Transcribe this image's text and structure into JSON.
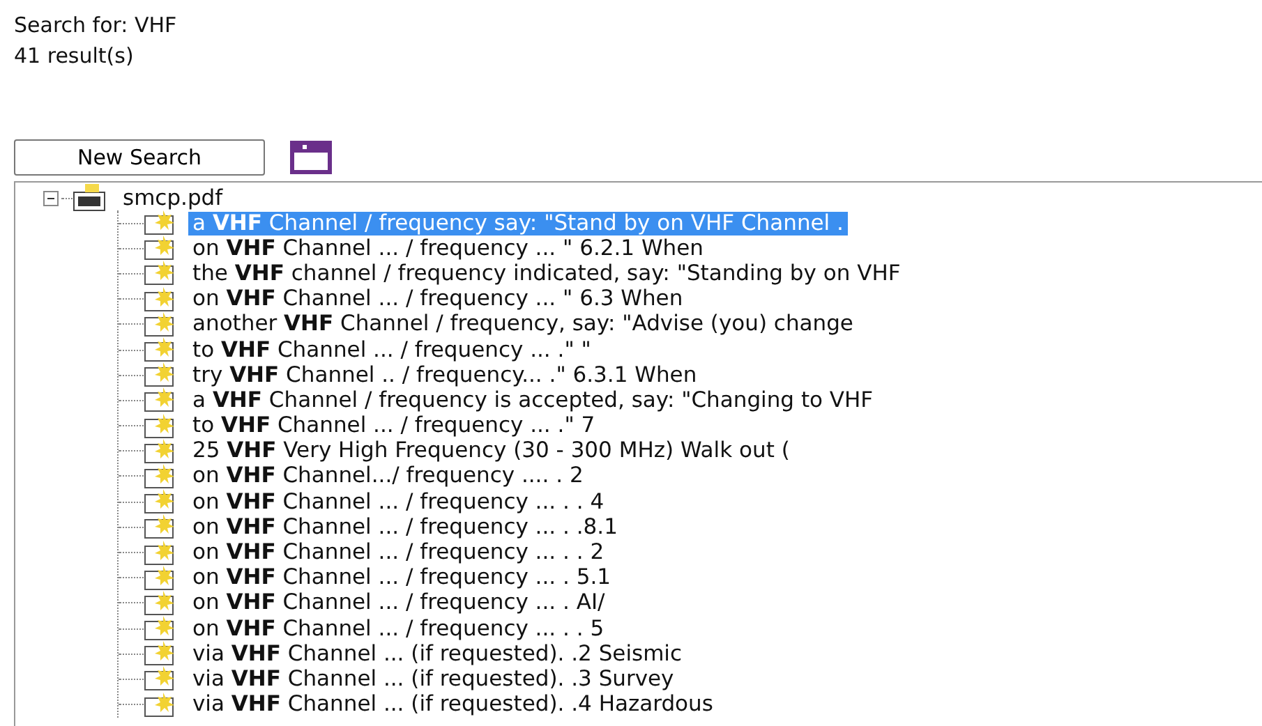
{
  "query": "Search for: VHF",
  "count": "41 result(s)",
  "new_search_button": "New Search",
  "tree": {
    "label": "smcp.pdf",
    "expanded": true,
    "children": [
      {
        "label": "a **VHF** Channel / frequency say: \"Stand by on VHF Channel .",
        "selected": true
      },
      {
        "label": "on **VHF** Channel ... / frequency ... \" 6.2.1 When",
        "selected": false
      },
      {
        "label": "the **VHF** channel / frequency indicated, say: \"Standing by on VHF",
        "selected": false
      },
      {
        "label": "on **VHF** Channel ... / frequency ... \" 6.3 When",
        "selected": false
      },
      {
        "label": "another **VHF** Channel / frequency, say: \"Advise (you) change",
        "selected": false
      },
      {
        "label": "to **VHF** Channel ... / frequency ... .\" \"",
        "selected": false
      },
      {
        "label": "try **VHF** Channel .. / frequency... .\" 6.3.1 When",
        "selected": false
      },
      {
        "label": "a **VHF** Channel / frequency is accepted, say: \"Changing to VHF",
        "selected": false
      },
      {
        "label": "to **VHF** Channel ... / frequency ... .\" 7",
        "selected": false
      },
      {
        "label": "25 **VHF** Very High Frequency (30 - 300 MHz) Walk out (",
        "selected": false
      },
      {
        "label": "on **VHF** Channel.../ frequency .... . 2",
        "selected": false
      },
      {
        "label": "on **VHF** Channel ... / frequency ... . . 4",
        "selected": false
      },
      {
        "label": "on **VHF** Channel ... / frequency ... . .8.1",
        "selected": false
      },
      {
        "label": "on **VHF** Channel ... / frequency ... . . 2",
        "selected": false
      },
      {
        "label": "on **VHF** Channel ... / frequency ... . 5.1",
        "selected": false
      },
      {
        "label": "on **VHF** Channel ... / frequency ... . AI/",
        "selected": false
      },
      {
        "label": "on **VHF** Channel ... / frequency ... . . 5",
        "selected": false
      },
      {
        "label": "via **VHF** Channel ... (if requested). .2 Seismic",
        "selected": false
      },
      {
        "label": "via **VHF** Channel ... (if requested). .3 Survey",
        "selected": false
      },
      {
        "label": "via **VHF** Channel ... (if requested). .4 Hazardous",
        "selected": false
      }
    ]
  }
}
